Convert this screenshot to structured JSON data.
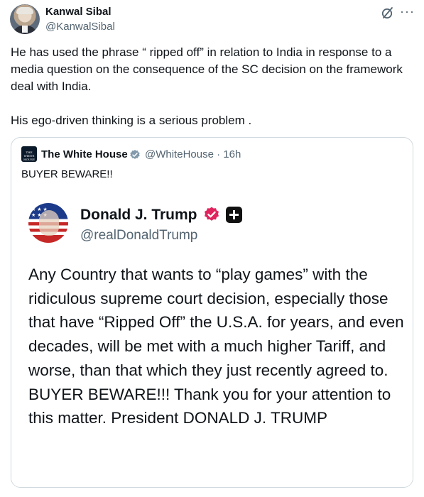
{
  "author": {
    "name": "Kanwal Sibal",
    "handle": "@KanwalSibal"
  },
  "post": {
    "paragraphs": [
      "He has used the phrase “ ripped off” in relation to India in response to a media question on the consequence of the SC decision on the framework deal  with India.",
      "His ego-driven thinking is a serious problem ."
    ]
  },
  "quoted": {
    "avatar_text": "THE WHITE HOUSE",
    "name": "The White House",
    "handle_time": "@WhiteHouse · 16h",
    "text": "BUYER BEWARE!!",
    "embedded": {
      "name": "Donald J. Trump",
      "handle": "@realDonaldTrump",
      "body": "Any Country that wants to “play games” with the ridiculous supreme court decision, especially those that have “Ripped Off” the U.S.A. for years, and even decades, will be met with a much higher Tariff, and worse, than that which they just recently agreed to. BUYER BEWARE!!! Thank you for your attention to this matter. President DONALD J. TRUMP"
    }
  },
  "icons": {
    "header": [
      "grok-icon",
      "more-icon"
    ],
    "verified_gray": "verified-gray-icon",
    "verified_pink": "verified-badge-icon",
    "plus": "plus-icon"
  },
  "colors": {
    "text_primary": "#0f1419",
    "text_secondary": "#536471",
    "border": "#cfd9de",
    "verified_gray": "#829aab",
    "truth_badge": "#e0245e"
  }
}
